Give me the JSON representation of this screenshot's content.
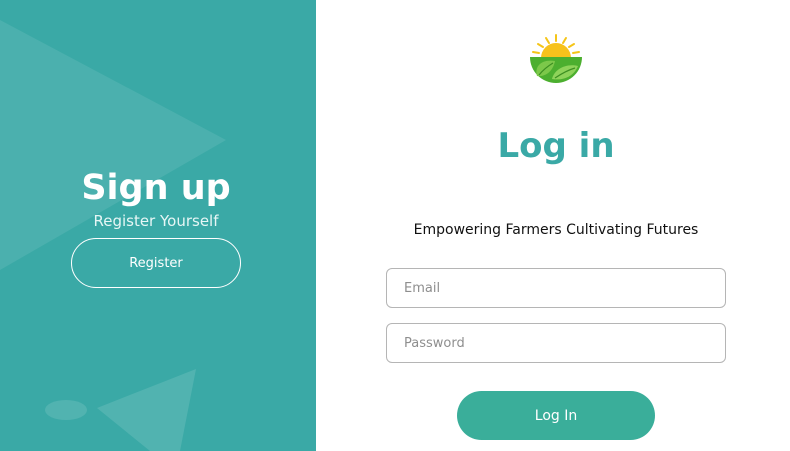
{
  "signup": {
    "title": "Sign up",
    "subtitle": "Register Yourself",
    "register_label": "Register"
  },
  "login": {
    "title": "Log in",
    "tagline": "Empowering Farmers Cultivating Futures",
    "email_placeholder": "Email",
    "password_placeholder": "Password",
    "submit_label": "Log In"
  },
  "colors": {
    "teal_panel": "#3aa9a6",
    "accent": "#3aa9a6",
    "button": "#3aae9a"
  },
  "icons": {
    "logo": "sun-leaf-logo-icon"
  }
}
